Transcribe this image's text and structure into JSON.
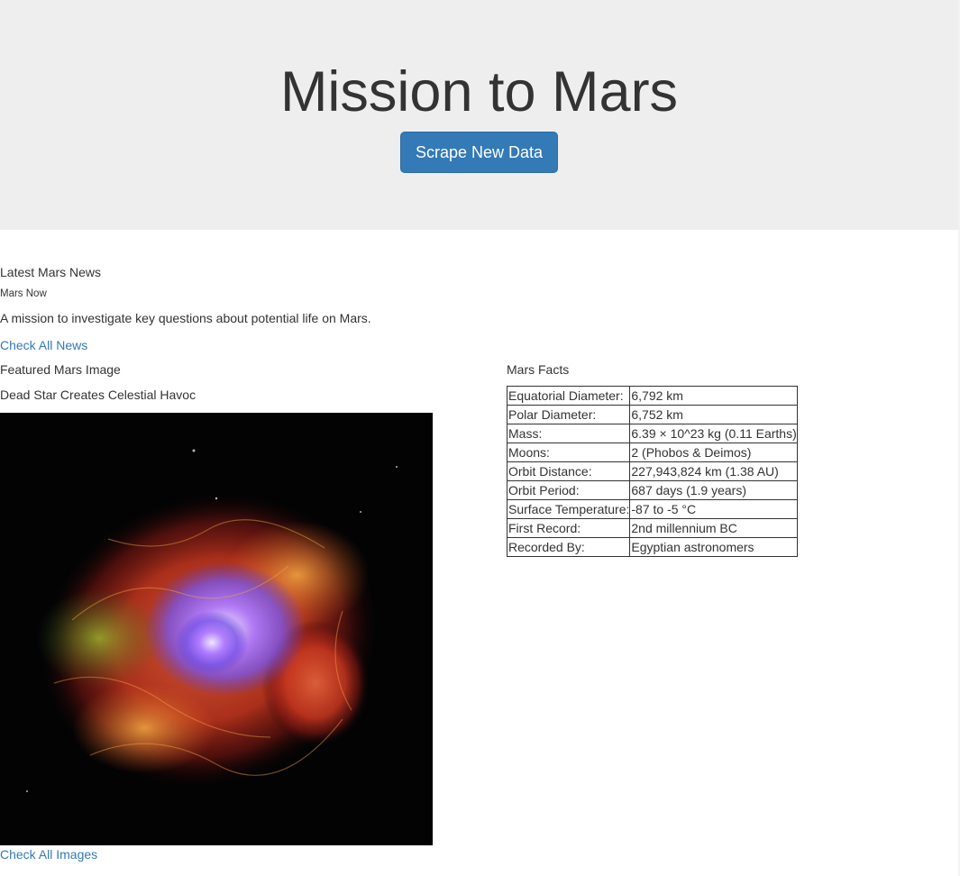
{
  "header": {
    "title": "Mission to Mars",
    "scrape_button_label": "Scrape New Data"
  },
  "news": {
    "section_label": "Latest Mars News",
    "headline": "Mars Now",
    "teaser": "A mission to investigate key questions about potential life on Mars.",
    "link_label": "Check All News"
  },
  "featured_image": {
    "section_label": "Featured Mars Image",
    "caption": "Dead Star Creates Celestial Havoc",
    "link_label": "Check All Images"
  },
  "facts": {
    "section_label": "Mars Facts",
    "rows": [
      {
        "label": "Equatorial Diameter:",
        "value": "6,792 km"
      },
      {
        "label": "Polar Diameter:",
        "value": "6,752 km"
      },
      {
        "label": "Mass:",
        "value": "6.39 × 10^23 kg (0.11 Earths)"
      },
      {
        "label": "Moons:",
        "value": "2 (Phobos & Deimos)"
      },
      {
        "label": "Orbit Distance:",
        "value": "227,943,824 km (1.38 AU)"
      },
      {
        "label": "Orbit Period:",
        "value": "687 days (1.9 years)"
      },
      {
        "label": "Surface Temperature:",
        "value": "-87 to -5 °C"
      },
      {
        "label": "First Record:",
        "value": "2nd millennium BC"
      },
      {
        "label": "Recorded By:",
        "value": "Egyptian astronomers"
      }
    ]
  },
  "colors": {
    "jumbotron_bg": "#eeeeee",
    "primary_button": "#337ab7",
    "link": "#337ab7",
    "text": "#333333"
  }
}
